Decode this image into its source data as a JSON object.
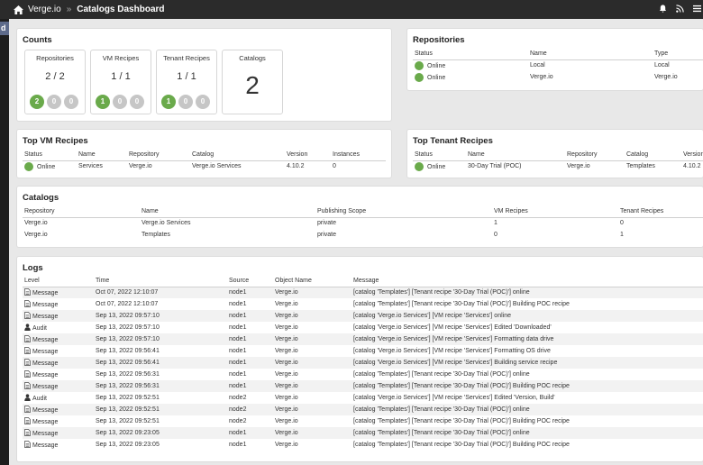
{
  "topbar": {
    "app_name": "Verge.io",
    "separator": "»",
    "page_title": "Catalogs Dashboard"
  },
  "left_tab": "d",
  "counts": {
    "title": "Counts",
    "repositories": {
      "label": "Repositories",
      "value": "2 / 2",
      "badges": [
        "2",
        "0",
        "0"
      ]
    },
    "vm_recipes": {
      "label": "VM Recipes",
      "value": "1 / 1",
      "badges": [
        "1",
        "0",
        "0"
      ]
    },
    "tenant_recipes": {
      "label": "Tenant Recipes",
      "value": "1 / 1",
      "badges": [
        "1",
        "0",
        "0"
      ]
    },
    "catalogs": {
      "label": "Catalogs",
      "value": "2"
    }
  },
  "repositories": {
    "title": "Repositories",
    "columns": [
      "Status",
      "Name",
      "Type"
    ],
    "rows": [
      {
        "status": "Online",
        "name": "Local",
        "type": "Local"
      },
      {
        "status": "Online",
        "name": "Verge.io",
        "type": "Verge.io"
      }
    ]
  },
  "top_vm_recipes": {
    "title": "Top VM Recipes",
    "columns": [
      "Status",
      "Name",
      "Repository",
      "Catalog",
      "Version",
      "Instances"
    ],
    "rows": [
      {
        "status": "Online",
        "name": "Services",
        "repository": "Verge.io",
        "catalog": "Verge.io Services",
        "version": "4.10.2",
        "instances": "0"
      }
    ]
  },
  "top_tenant_recipes": {
    "title": "Top Tenant Recipes",
    "columns": [
      "Status",
      "Name",
      "Repository",
      "Catalog",
      "Version"
    ],
    "rows": [
      {
        "status": "Online",
        "name": "30-Day Trial (POC)",
        "repository": "Verge.io",
        "catalog": "Templates",
        "version": "4.10.2"
      }
    ]
  },
  "catalogs": {
    "title": "Catalogs",
    "columns": [
      "Repository",
      "Name",
      "Publishing Scope",
      "VM Recipes",
      "Tenant Recipes"
    ],
    "rows": [
      {
        "repository": "Verge.io",
        "name": "Verge.io Services",
        "scope": "private",
        "vm": "1",
        "tenant": "0"
      },
      {
        "repository": "Verge.io",
        "name": "Templates",
        "scope": "private",
        "vm": "0",
        "tenant": "1"
      }
    ]
  },
  "logs": {
    "title": "Logs",
    "columns": [
      "Level",
      "Time",
      "Source",
      "Object Name",
      "Message"
    ],
    "rows": [
      {
        "level": "Message",
        "time": "Oct 07, 2022 12:10:07",
        "source": "node1",
        "object": "Verge.io",
        "message": "[catalog 'Templates'] [Tenant recipe '30-Day Trial (POC)'] online"
      },
      {
        "level": "Message",
        "time": "Oct 07, 2022 12:10:07",
        "source": "node1",
        "object": "Verge.io",
        "message": "[catalog 'Templates'] [Tenant recipe '30-Day Trial (POC)'] Building POC recipe"
      },
      {
        "level": "Message",
        "time": "Sep 13, 2022 09:57:10",
        "source": "node1",
        "object": "Verge.io",
        "message": "[catalog 'Verge.io Services'] [VM recipe 'Services'] online"
      },
      {
        "level": "Audit",
        "time": "Sep 13, 2022 09:57:10",
        "source": "node1",
        "object": "Verge.io",
        "message": "[catalog 'Verge.io Services'] [VM recipe 'Services'] Edited 'Downloaded'"
      },
      {
        "level": "Message",
        "time": "Sep 13, 2022 09:57:10",
        "source": "node1",
        "object": "Verge.io",
        "message": "[catalog 'Verge.io Services'] [VM recipe 'Services'] Formatting data drive"
      },
      {
        "level": "Message",
        "time": "Sep 13, 2022 09:56:41",
        "source": "node1",
        "object": "Verge.io",
        "message": "[catalog 'Verge.io Services'] [VM recipe 'Services'] Formatting OS drive"
      },
      {
        "level": "Message",
        "time": "Sep 13, 2022 09:56:41",
        "source": "node1",
        "object": "Verge.io",
        "message": "[catalog 'Verge.io Services'] [VM recipe 'Services'] Building service recipe"
      },
      {
        "level": "Message",
        "time": "Sep 13, 2022 09:56:31",
        "source": "node1",
        "object": "Verge.io",
        "message": "[catalog 'Templates'] [Tenant recipe '30-Day Trial (POC)'] online"
      },
      {
        "level": "Message",
        "time": "Sep 13, 2022 09:56:31",
        "source": "node1",
        "object": "Verge.io",
        "message": "[catalog 'Templates'] [Tenant recipe '30-Day Trial (POC)'] Building POC recipe"
      },
      {
        "level": "Audit",
        "time": "Sep 13, 2022 09:52:51",
        "source": "node2",
        "object": "Verge.io",
        "message": "[catalog 'Verge.io Services'] [VM recipe 'Services'] Edited 'Version, Build'"
      },
      {
        "level": "Message",
        "time": "Sep 13, 2022 09:52:51",
        "source": "node2",
        "object": "Verge.io",
        "message": "[catalog 'Templates'] [Tenant recipe '30-Day Trial (POC)'] online"
      },
      {
        "level": "Message",
        "time": "Sep 13, 2022 09:52:51",
        "source": "node2",
        "object": "Verge.io",
        "message": "[catalog 'Templates'] [Tenant recipe '30-Day Trial (POC)'] Building POC recipe"
      },
      {
        "level": "Message",
        "time": "Sep 13, 2022 09:23:05",
        "source": "node1",
        "object": "Verge.io",
        "message": "[catalog 'Templates'] [Tenant recipe '30-Day Trial (POC)'] online"
      },
      {
        "level": "Message",
        "time": "Sep 13, 2022 09:23:05",
        "source": "node1",
        "object": "Verge.io",
        "message": "[catalog 'Templates'] [Tenant recipe '30-Day Trial (POC)'] Building POC recipe"
      }
    ]
  }
}
